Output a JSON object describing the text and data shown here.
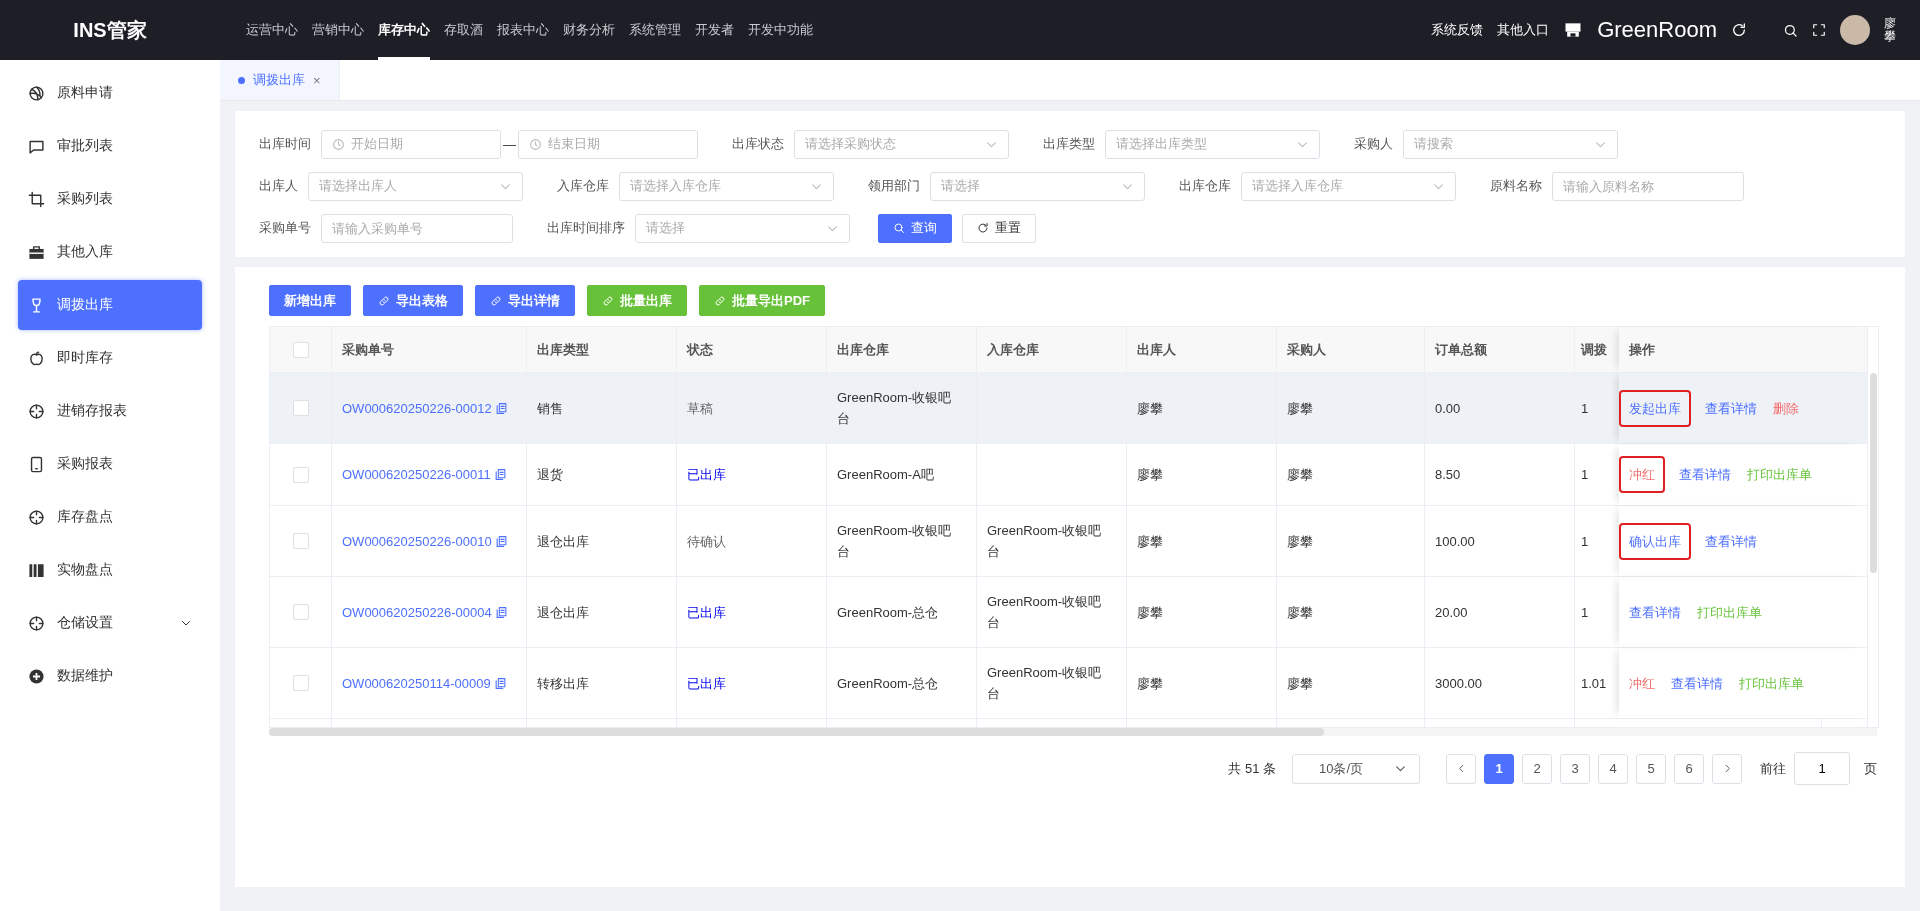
{
  "app": {
    "logo": "INS管家"
  },
  "nav": [
    {
      "label": "运营中心",
      "selected": false
    },
    {
      "label": "营销中心",
      "selected": false
    },
    {
      "label": "库存中心",
      "selected": true
    },
    {
      "label": "存取酒",
      "selected": false
    },
    {
      "label": "报表中心",
      "selected": false
    },
    {
      "label": "财务分析",
      "selected": false
    },
    {
      "label": "系统管理",
      "selected": false
    },
    {
      "label": "开发者",
      "selected": false
    },
    {
      "label": "开发中功能",
      "selected": false
    }
  ],
  "header_right": {
    "links": [
      "系统反馈",
      "其他入口"
    ],
    "store": "GreenRoom",
    "user": "廖攀"
  },
  "sidebar": {
    "items": [
      {
        "label": "原料申请",
        "selected": false,
        "expandable": false
      },
      {
        "label": "审批列表",
        "selected": false,
        "expandable": false
      },
      {
        "label": "采购列表",
        "selected": false,
        "expandable": false
      },
      {
        "label": "其他入库",
        "selected": false,
        "expandable": false
      },
      {
        "label": "调拨出库",
        "selected": true,
        "expandable": false
      },
      {
        "label": "即时库存",
        "selected": false,
        "expandable": false
      },
      {
        "label": "进销存报表",
        "selected": false,
        "expandable": false
      },
      {
        "label": "采购报表",
        "selected": false,
        "expandable": false
      },
      {
        "label": "库存盘点",
        "selected": false,
        "expandable": false
      },
      {
        "label": "实物盘点",
        "selected": false,
        "expandable": false
      },
      {
        "label": "仓储设置",
        "selected": false,
        "expandable": true
      },
      {
        "label": "数据维护",
        "selected": false,
        "expandable": false
      }
    ]
  },
  "tabs": [
    {
      "label": "调拨出库",
      "selected": true,
      "close": "×"
    }
  ],
  "filter_rows": [
    {
      "fields": [
        {
          "label": "出库时间",
          "kind": "date-range",
          "placeholder": "开始日期",
          "placeholder_end": "结束日期",
          "separator": "—"
        },
        {
          "label": "出库状态",
          "kind": "select",
          "placeholder": "请选择采购状态"
        },
        {
          "label": "出库类型",
          "kind": "select",
          "placeholder": "请选择出库类型"
        },
        {
          "label": "采购人",
          "kind": "select",
          "placeholder": "请搜索"
        }
      ]
    },
    {
      "fields": [
        {
          "label": "出库人",
          "kind": "select",
          "placeholder": "请选择出库人"
        },
        {
          "label": "入库仓库",
          "kind": "select",
          "placeholder": "请选择入库仓库"
        },
        {
          "label": "领用部门",
          "kind": "select",
          "placeholder": "请选择"
        },
        {
          "label": "出库仓库",
          "kind": "select",
          "placeholder": "请选择入库仓库"
        },
        {
          "label": "原料名称",
          "kind": "input",
          "placeholder": "请输入原料名称"
        }
      ]
    },
    {
      "fields": [
        {
          "label": "采购单号",
          "kind": "input",
          "placeholder": "请输入采购单号"
        },
        {
          "label": "出库时间排序",
          "kind": "select",
          "placeholder": "请选择"
        }
      ],
      "actions": [
        {
          "label": "查询",
          "kind": "primary"
        },
        {
          "label": "重置",
          "kind": "default"
        }
      ]
    }
  ],
  "toolbar": [
    {
      "label": "新增出库",
      "kind": "primary",
      "icon": false
    },
    {
      "label": "导出表格",
      "kind": "primary",
      "icon": true
    },
    {
      "label": "导出详情",
      "kind": "primary",
      "icon": true
    },
    {
      "label": "批量出库",
      "kind": "success",
      "icon": true
    },
    {
      "label": "批量导出PDF",
      "kind": "success",
      "icon": true
    }
  ],
  "table": {
    "header_checked": false,
    "columns": [
      "采购单号",
      "出库类型",
      "状态",
      "出库仓库",
      "入库仓库",
      "出库人",
      "采购人",
      "订单总额",
      "调拨",
      "操作"
    ],
    "rows": [
      {
        "hovered": true,
        "checked": false,
        "order_no": "OW000620250226-00012",
        "type": "销售",
        "status": {
          "label": "草稿",
          "kind": "muted"
        },
        "out_wh": "GreenRoom-收银吧台",
        "in_wh": "",
        "out_person": "廖攀",
        "buyer": "廖攀",
        "total": "0.00",
        "column_9": "1",
        "actions": [
          {
            "label": "发起出库",
            "kind": "link",
            "highlighted": true
          },
          {
            "label": "查看详情",
            "kind": "link",
            "highlighted": false
          },
          {
            "label": "删除",
            "kind": "danger",
            "highlighted": false
          }
        ]
      },
      {
        "hovered": false,
        "checked": false,
        "order_no": "OW000620250226-00011",
        "type": "退货",
        "status": {
          "label": "已出库",
          "kind": "done"
        },
        "out_wh": "GreenRoom-A吧",
        "in_wh": "",
        "out_person": "廖攀",
        "buyer": "廖攀",
        "total": "8.50",
        "column_9": "1",
        "actions": [
          {
            "label": "冲红",
            "kind": "danger",
            "highlighted": true
          },
          {
            "label": "查看详情",
            "kind": "link",
            "highlighted": false
          },
          {
            "label": "打印出库单",
            "kind": "success",
            "highlighted": false
          }
        ]
      },
      {
        "hovered": false,
        "checked": false,
        "order_no": "OW000620250226-00010",
        "type": "退仓出库",
        "status": {
          "label": "待确认",
          "kind": "muted"
        },
        "out_wh": "GreenRoom-收银吧台",
        "in_wh": "GreenRoom-收银吧台",
        "out_person": "廖攀",
        "buyer": "廖攀",
        "total": "100.00",
        "column_9": "1",
        "actions": [
          {
            "label": "确认出库",
            "kind": "link",
            "highlighted": true
          },
          {
            "label": "查看详情",
            "kind": "link",
            "highlighted": false
          }
        ]
      },
      {
        "hovered": false,
        "checked": false,
        "order_no": "OW000620250226-00004",
        "type": "退仓出库",
        "status": {
          "label": "已出库",
          "kind": "done"
        },
        "out_wh": "GreenRoom-总仓",
        "in_wh": "GreenRoom-收银吧台",
        "out_person": "廖攀",
        "buyer": "廖攀",
        "total": "20.00",
        "column_9": "1",
        "actions": [
          {
            "label": "查看详情",
            "kind": "link",
            "highlighted": false
          },
          {
            "label": "打印出库单",
            "kind": "success",
            "highlighted": false
          }
        ]
      },
      {
        "hovered": false,
        "checked": false,
        "order_no": "OW000620250114-00009",
        "type": "转移出库",
        "status": {
          "label": "已出库",
          "kind": "done"
        },
        "out_wh": "GreenRoom-总仓",
        "in_wh": "GreenRoom-收银吧台",
        "out_person": "廖攀",
        "buyer": "廖攀",
        "total": "3000.00",
        "column_9": "1.01",
        "actions": [
          {
            "label": "冲红",
            "kind": "danger",
            "highlighted": false
          },
          {
            "label": "查看详情",
            "kind": "link",
            "highlighted": false
          },
          {
            "label": "打印出库单",
            "kind": "success",
            "highlighted": false
          }
        ]
      }
    ]
  },
  "pagination": {
    "total": "共 51 条",
    "page_size": "10条/页",
    "pages": [
      {
        "label": "1",
        "selected": true
      },
      {
        "label": "2",
        "selected": false
      },
      {
        "label": "3",
        "selected": false
      },
      {
        "label": "4",
        "selected": false
      },
      {
        "label": "5",
        "selected": false
      },
      {
        "label": "6",
        "selected": false
      }
    ],
    "goto_label": "前往",
    "goto_value": "1",
    "goto_suffix": "页"
  }
}
